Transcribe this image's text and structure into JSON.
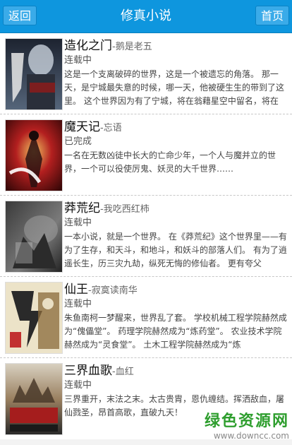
{
  "header": {
    "back_label": "返回",
    "title": "修真小说",
    "home_label": "首页"
  },
  "books": [
    {
      "title": "造化之门",
      "author": "-鹅是老五",
      "status": "连载中",
      "desc": "这是一个支离破碎的世界，这是一个被遗忘的角落。 那一天，是宁城最失意的时候，哪一天，他被硬生生的带到了这里。 这个世界因为有了宁城，将在翁藉星空中留名，将在",
      "cover_colors": [
        "#2a2f3a",
        "#5c6a7a",
        "#c9d2dc"
      ]
    },
    {
      "title": "魔天记",
      "author": "-忘语",
      "status": "已完成",
      "desc": "一名在无数凶徒中长大的亡命少年，一个人与魔并立的世界，一个可以役使厉鬼、妖灵的大千世界……",
      "cover_colors": [
        "#5a0d0d",
        "#b31f1f",
        "#f0c060"
      ]
    },
    {
      "title": "莽荒纪",
      "author": "-我吃西红柿",
      "status": "连载中",
      "desc": "一本小说，就是一个世界。 在《莽荒纪》这个世界里——有为了生存，和天斗，和地斗，和妖斗的部落人们。 有为了逍遥长生，历三灾九劫，纵死无悔的修仙者。 更有夸父",
      "cover_colors": [
        "#2b2b2b",
        "#6b6b6b",
        "#bdbdbd"
      ]
    },
    {
      "title": "仙王",
      "author": "-寂寞读南华",
      "status": "连载中",
      "desc": "朱鱼南柯一梦醒来，世界乱了套。 学校机械工程学院赫然成为“傀儡堂”。 药理学院赫然成为“炼药堂”。 农业技术学院赫然成为“灵食堂”。 土木工程学院赫然成为“炼",
      "cover_colors": [
        "#e9dfc4",
        "#8a6a3a",
        "#c23030"
      ]
    },
    {
      "title": "三界血歌",
      "author": "-血红",
      "status": "连载中",
      "desc": "三界重开，末法之末。太古贵胄，恩仇缠结。挥洒敌血，屠仙戮圣，昂首高歌，直破九天！",
      "cover_colors": [
        "#3a3a3a",
        "#9a8060",
        "#d8d0c0"
      ]
    }
  ],
  "watermark": {
    "main": "绿色资源网",
    "url": "www.downcc.com"
  }
}
